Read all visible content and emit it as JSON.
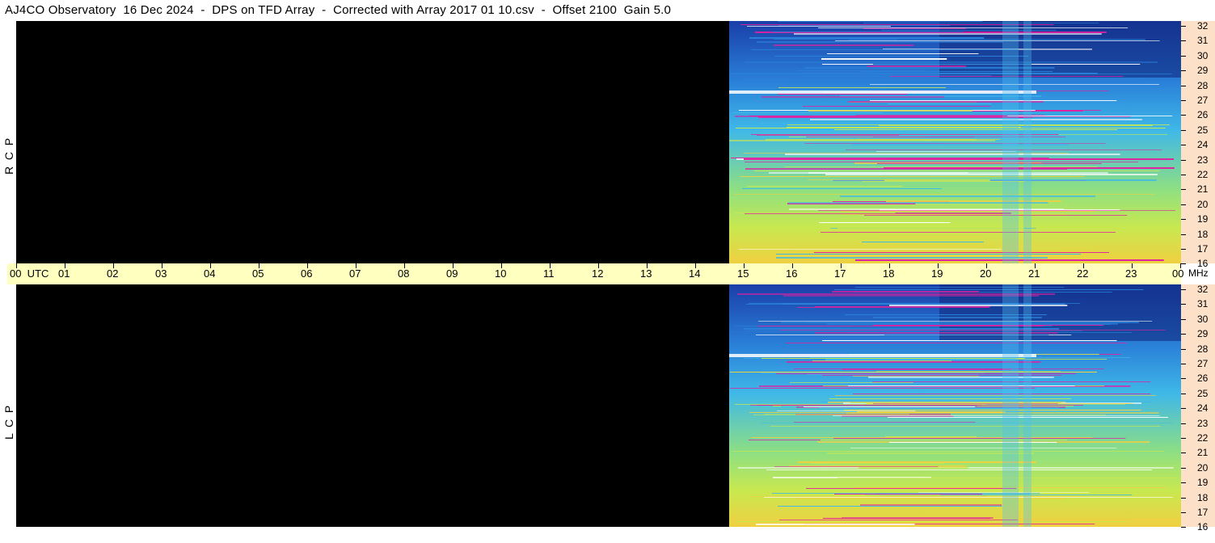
{
  "title": "AJ4CO Observatory  16 Dec 2024  -  DPS on TFD Array  -  Corrected with Array 2017 01 10.csv  -  Offset 2100  Gain 5.0",
  "panels": [
    {
      "label": "R  C  P",
      "name": "rcp"
    },
    {
      "label": "L  C  P",
      "name": "lcp"
    }
  ],
  "time_axis": {
    "labels": [
      "00  UTC",
      "01",
      "02",
      "03",
      "04",
      "05",
      "06",
      "07",
      "08",
      "09",
      "10",
      "11",
      "12",
      "13",
      "14",
      "15",
      "16",
      "17",
      "18",
      "19",
      "20",
      "21",
      "22",
      "23",
      "00"
    ],
    "unit": "MHz"
  },
  "freq_axis": {
    "labels": [
      "32",
      "31",
      "30",
      "29",
      "28",
      "27",
      "26",
      "25",
      "24",
      "23",
      "22",
      "21",
      "20",
      "19",
      "18",
      "17",
      "16"
    ]
  },
  "data_start_hour": 14.7,
  "colors": {
    "background": "#000000",
    "axis_strip": "#ffffc0",
    "freq_strip": "#fde0c8",
    "low": "#1a3fa8",
    "mid": "#3fb8e8",
    "high": "#c8e850",
    "peak": "#f0d040",
    "burst": "#e020a0"
  }
}
